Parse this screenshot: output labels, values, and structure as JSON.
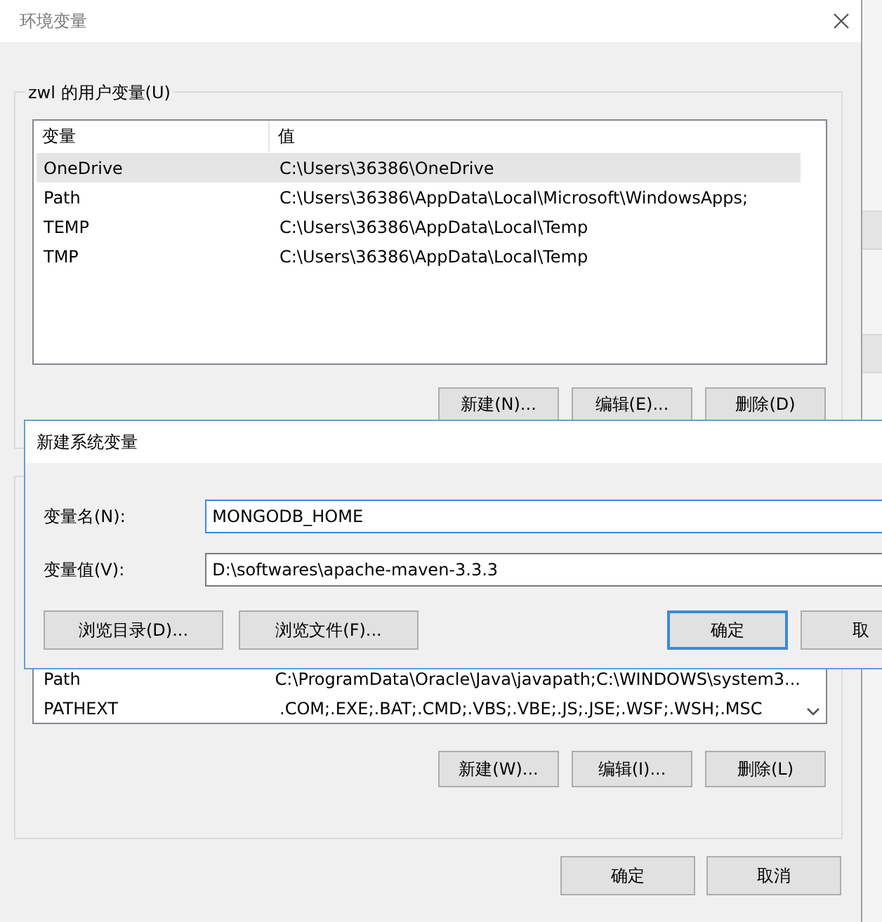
{
  "window": {
    "title": "环境变量"
  },
  "user_variables": {
    "label": "zwl 的用户变量(U)",
    "columns": [
      "变量",
      "值"
    ],
    "rows": [
      {
        "name": "OneDrive",
        "value": "C:\\Users\\36386\\OneDrive",
        "selected": true
      },
      {
        "name": "Path",
        "value": "C:\\Users\\36386\\AppData\\Local\\Microsoft\\WindowsApps;",
        "selected": false
      },
      {
        "name": "TEMP",
        "value": "C:\\Users\\36386\\AppData\\Local\\Temp",
        "selected": false
      },
      {
        "name": "TMP",
        "value": "C:\\Users\\36386\\AppData\\Local\\Temp",
        "selected": false
      }
    ],
    "buttons": [
      "新建(N)...",
      "编辑(E)...",
      "删除(D)"
    ]
  },
  "system_variables": {
    "rows": [
      {
        "name": "Path",
        "value": "C:\\ProgramData\\Oracle\\Java\\javapath;C:\\WINDOWS\\system3...",
        "selected": false
      },
      {
        "name": "PATHEXT",
        "value": ".COM;.EXE;.BAT;.CMD;.VBS;.VBE;.JS;.JSE;.WSF;.WSH;.MSC",
        "selected": false
      }
    ],
    "buttons": [
      "新建(W)...",
      "编辑(I)...",
      "删除(L)"
    ]
  },
  "buttons": [
    "确定",
    "取消"
  ],
  "new_variable_dialog": {
    "title": "新建系统变量",
    "fields": [
      {
        "label": "变量名(N):",
        "value": "MONGODB_HOME",
        "focused": true
      },
      {
        "label": "变量值(V):",
        "value": "D:\\softwares\\apache-maven-3.3.3",
        "focused": false
      }
    ],
    "browse_buttons": [
      "浏览目录(D)...",
      "浏览文件(F)..."
    ],
    "buttons": [
      {
        "label": "确定",
        "default": true
      },
      {
        "label": "取",
        "default": false
      }
    ]
  }
}
